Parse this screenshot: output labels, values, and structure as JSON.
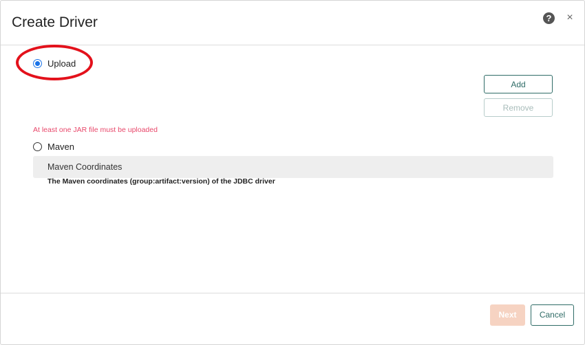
{
  "dialog": {
    "title": "Create Driver",
    "help_icon": "question-circle-icon",
    "help_glyph": "?",
    "close_icon": "close-icon",
    "close_glyph": "×"
  },
  "upload": {
    "label": "Upload",
    "selected": true,
    "add_label": "Add",
    "remove_label": "Remove",
    "error": "At least one JAR file must be uploaded"
  },
  "maven": {
    "label": "Maven",
    "selected": false,
    "coordinates_label": "Maven Coordinates",
    "hint": "The Maven coordinates (group:artifact:version) of the JDBC driver"
  },
  "footer": {
    "next_label": "Next",
    "cancel_label": "Cancel"
  },
  "colors": {
    "accent": "#2e6b66",
    "radio_selected": "#1a73e8",
    "error": "#e8476a",
    "next_disabled": "#f6d3c2",
    "annotation": "#e3111b"
  }
}
